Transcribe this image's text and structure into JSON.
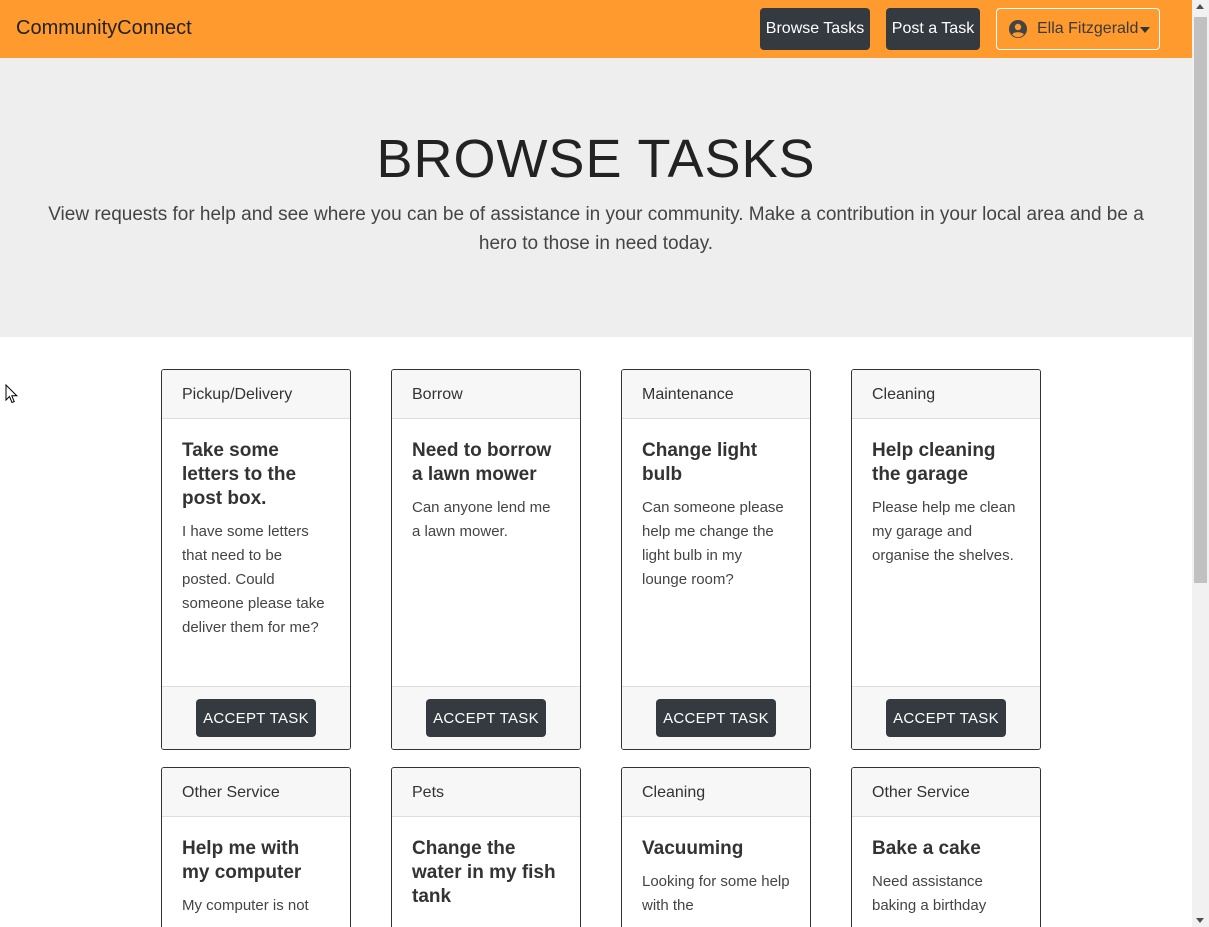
{
  "navbar": {
    "brand": "CommunityConnect",
    "browse_label": "Browse Tasks",
    "post_label": "Post a Task",
    "user_name": "Ella Fitzgerald",
    "color": "#ff9a2e"
  },
  "hero": {
    "title": "BROWSE TASKS",
    "subtitle": "View requests for help and see where you can be of assistance in your community. Make a contribution in your local area and be a hero to those in need today."
  },
  "tasks": [
    {
      "category": "Pickup/Delivery",
      "title": "Take some letters to the post box.",
      "description": "I have some letters that need to be posted. Could someone please take deliver them for me?",
      "button": "ACCEPT TASK"
    },
    {
      "category": "Borrow",
      "title": "Need to borrow a lawn mower",
      "description": "Can anyone lend me a lawn mower.",
      "button": "ACCEPT TASK"
    },
    {
      "category": "Maintenance",
      "title": "Change light bulb",
      "description": "Can someone please help me change the light bulb in my lounge room?",
      "button": "ACCEPT TASK"
    },
    {
      "category": "Cleaning",
      "title": "Help cleaning the garage",
      "description": "Please help me clean my garage and organise the shelves.",
      "button": "ACCEPT TASK"
    },
    {
      "category": "Other Service",
      "title": "Help me with my computer",
      "description": "My computer is not",
      "button": ""
    },
    {
      "category": "Pets",
      "title": "Change the water in my fish tank",
      "description": "",
      "button": ""
    },
    {
      "category": "Cleaning",
      "title": "Vacuuming",
      "description": "Looking for some help with the",
      "button": ""
    },
    {
      "category": "Other Service",
      "title": "Bake a cake",
      "description": "Need assistance baking a birthday",
      "button": ""
    }
  ]
}
